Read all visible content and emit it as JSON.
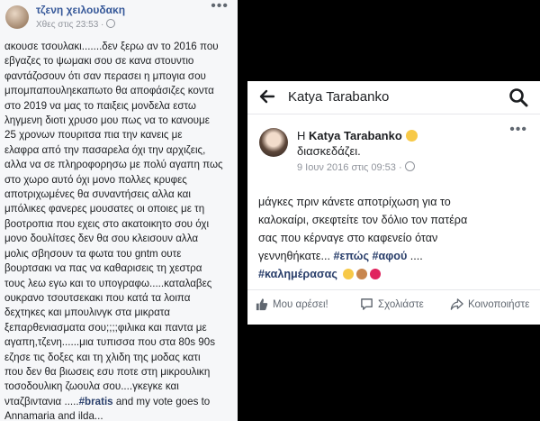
{
  "left_post": {
    "author": "τζενη χειλουδακη",
    "timestamp": "Χθες στις 23:53 ·",
    "more": "•••",
    "lines": [
      "ακουσε τσουλακι.......δεν ξερω αν το 2016 που",
      "εβγαζες το ψωμακι σου σε κανα στουντιο",
      "φαντάζοσουν ότι σαν περασει η μπογια σου",
      "μπομπαπουληεκαπωτο θα αποφάσιζες κοντα",
      "στο 2019 να μας το παιξεις μονδελα εστω",
      "ληγμενη διοτι χρυσο μου πως να το κανουμε",
      "25 χρονων πουριτσα πια την κανεις με",
      "ελαφρα από την πασαρελα όχι την αρχιζεις,",
      "αλλα να σε πληροφορησω με πολύ αγαπη πως",
      "στο χωρο αυτό όχι μονο πολλες κρυφες",
      "αποτριχωμένες θα συναντήσεις αλλα και",
      "μπόλικες φανερες μουσατες οι οποιες με τη",
      "βοοτροπια που εχεις στο ακατοικητο σου όχι",
      "μονο δουλίτσες δεν θα σου κλεισουν αλλα",
      "μολις σβησουν τα φωτα του gntm ουτε",
      "βουρτσακι να πας να καθαρισεις τη χεστρα",
      "τους λεω εγω και το υπογραφω.....καταλαβες",
      "ουκρανο τσουτσεκακι που κατά τα λοιπα",
      "δεχτηκες και μπουλινγκ στα μικρατα",
      "ξεπαρθενιασματα σου;;;;φιλικα και παντα με",
      "αγαπη,τζενη......μια τυπισσα που στα 80s 90s",
      "εζησε τις δοξες και τη χλιδη της μοδας κατι",
      "που δεν θα βιωσεις εσυ ποτε στη μικρουλικη",
      "τοσοδουλικη ζωουλα σου....γκεγκε και",
      "νταζβιντανια .....#bratis and my vote goes to",
      "Annamaria and ilda..."
    ]
  },
  "right_post": {
    "topbar_title": "Katya Tarabanko",
    "headline_prefix": "Η ",
    "headline_name": "Katya Tarabanko",
    "feeling": "διασκεδάζει.",
    "date": "9 Ιουν 2016 στις 09:53 ·",
    "more": "•••",
    "line1": "μάγκες  πριν κάνετε αποτρίχωση για το",
    "line2": "καλοκαίρι, σκεφτείτε τον δόλιο τον πατέρα",
    "line3": "σας που κέρναγε στο καφενείο όταν",
    "line4_text": "γεννηθήκατε... ",
    "line4_tag1": "#επώς",
    "line4_tag2": "#αφού",
    "line4_end": " ....",
    "line5_tag": "#καλημέρασας",
    "emoji_colors": [
      "#f7c948",
      "#f1a54a",
      "#e0245e"
    ],
    "actions": {
      "like": "Μου αρέσει!",
      "comment": "Σχολιάστε",
      "share": "Κοινοποιήστε"
    }
  }
}
